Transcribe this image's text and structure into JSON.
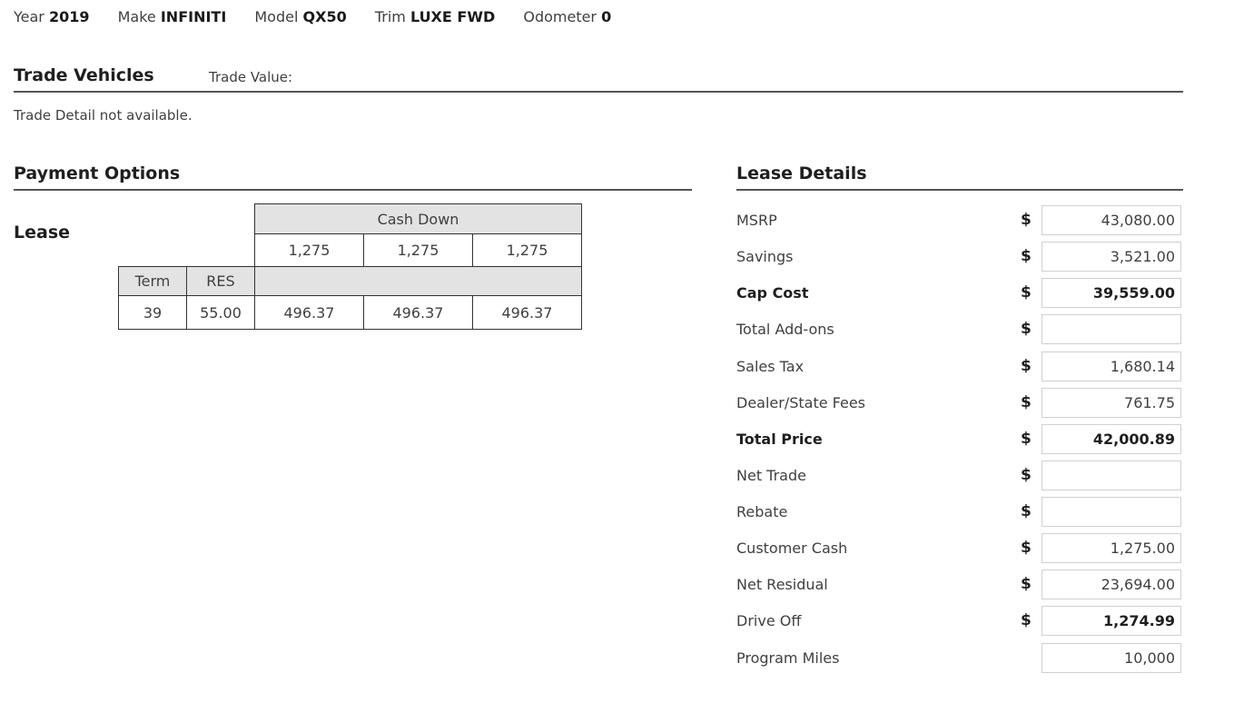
{
  "vehicle": {
    "year_label": "Year",
    "year": "2019",
    "make_label": "Make",
    "make": "INFINITI",
    "model_label": "Model",
    "model": "QX50",
    "trim_label": "Trim",
    "trim": "LUXE FWD",
    "odometer_label": "Odometer",
    "odometer": "0"
  },
  "trade": {
    "title": "Trade Vehicles",
    "value_label": "Trade Value:",
    "detail_text": "Trade Detail not available."
  },
  "payment": {
    "title": "Payment Options",
    "lease_label": "Lease",
    "cash_down_header": "Cash Down",
    "cash_down_values": [
      "1,275",
      "1,275",
      "1,275"
    ],
    "term_header": "Term",
    "res_header": "RES",
    "term": "39",
    "res": "55.00",
    "payments": [
      "496.37",
      "496.37",
      "496.37"
    ]
  },
  "lease_details": {
    "title": "Lease Details",
    "currency_symbol": "$",
    "rows": [
      {
        "label": "MSRP",
        "value": "43,080.00"
      },
      {
        "label": "Savings",
        "value": "3,521.00"
      },
      {
        "label": "Cap Cost",
        "value": "39,559.00"
      },
      {
        "label": "Total Add-ons",
        "value": ""
      },
      {
        "label": "Sales Tax",
        "value": "1,680.14"
      },
      {
        "label": "Dealer/State Fees",
        "value": "761.75"
      },
      {
        "label": "Total Price",
        "value": "42,000.89"
      },
      {
        "label": "Net Trade",
        "value": ""
      },
      {
        "label": "Rebate",
        "value": ""
      },
      {
        "label": "Customer Cash",
        "value": "1,275.00"
      },
      {
        "label": "Net Residual",
        "value": "23,694.00"
      },
      {
        "label": "Drive Off",
        "value": "1,274.99"
      },
      {
        "label": "Program Miles",
        "value": "10,000"
      }
    ]
  }
}
